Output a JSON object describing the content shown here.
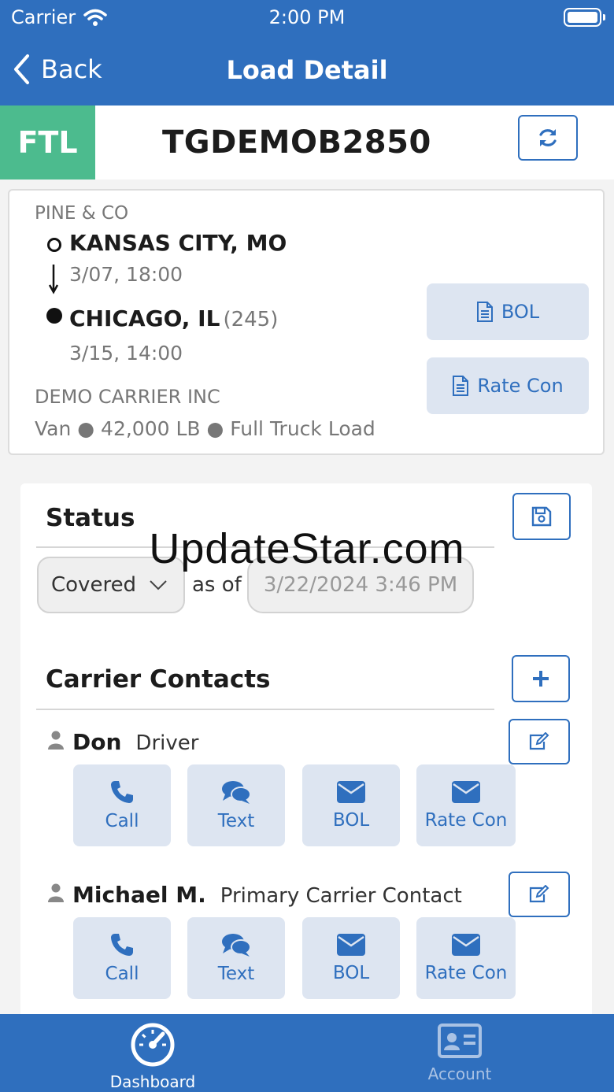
{
  "status_bar": {
    "carrier": "Carrier",
    "time": "2:00 PM"
  },
  "nav": {
    "back_label": "Back",
    "title": "Load Detail"
  },
  "load": {
    "mode": "FTL",
    "id": "TGDEMOB2850"
  },
  "route": {
    "shipper": "PINE & CO",
    "origin_city": "KANSAS CITY, MO",
    "origin_date": "3/07, 18:00",
    "destination_city": "CHICAGO, IL",
    "destination_miles": "(245)",
    "destination_date": "3/15, 14:00",
    "carrier": "DEMO CARRIER INC",
    "equipment": "Van ● 42,000 LB ● Full Truck Load",
    "bol_label": "BOL",
    "ratecon_label": "Rate Con"
  },
  "status_section": {
    "title": "Status",
    "selected": "Covered",
    "as_of_label": "as of",
    "timestamp": "3/22/2024 3:46 PM"
  },
  "contacts_section": {
    "title": "Carrier Contacts",
    "contacts": [
      {
        "name": "Don",
        "role": "Driver"
      },
      {
        "name": "Michael M.",
        "role": "Primary Carrier Contact"
      }
    ],
    "actions": {
      "call": "Call",
      "text": "Text",
      "bol": "BOL",
      "ratecon": "Rate Con"
    }
  },
  "tabbar": {
    "dashboard": "Dashboard",
    "account": "Account"
  },
  "watermark": "UpdateStar.com",
  "colors": {
    "brand_blue": "#2f6fbe",
    "ftl_green": "#4cbb8e",
    "button_fill": "#dde5f1"
  }
}
